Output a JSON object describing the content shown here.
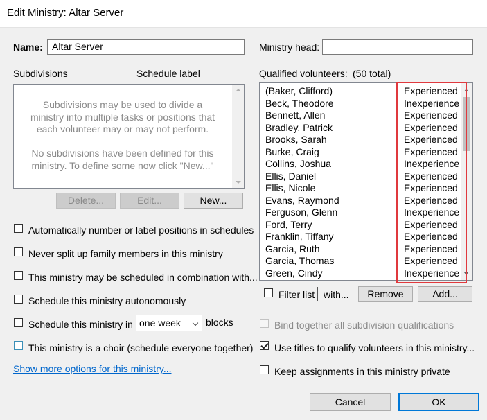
{
  "window": {
    "title": "Edit Ministry: Altar Server"
  },
  "name_field": {
    "label": "Name:",
    "value": "Altar Server"
  },
  "ministry_head": {
    "label": "Ministry head:",
    "value": ""
  },
  "subdivisions": {
    "header": "Subdivisions",
    "schedule_label_header": "Schedule label",
    "empty_text": "Subdivisions may be used to divide a\nministry into multiple tasks or positions that\neach volunteer may or may not perform.\n\nNo subdivisions have been defined for this\nministry. To define some now click \"New...\"",
    "buttons": {
      "delete": "Delete...",
      "edit": "Edit...",
      "new": "New..."
    }
  },
  "qualified": {
    "header": "Qualified volunteers:",
    "total": "(50 total)",
    "volunteers": [
      {
        "name": "(Baker, Clifford)",
        "status": "Experienced"
      },
      {
        "name": "Beck, Theodore",
        "status": "Inexperience"
      },
      {
        "name": "Bennett, Allen",
        "status": "Experienced"
      },
      {
        "name": "Bradley, Patrick",
        "status": "Experienced"
      },
      {
        "name": "Brooks, Sarah",
        "status": "Experienced"
      },
      {
        "name": "Burke, Craig",
        "status": "Experienced"
      },
      {
        "name": "Collins, Joshua",
        "status": "Inexperience"
      },
      {
        "name": "Ellis, Daniel",
        "status": "Experienced"
      },
      {
        "name": "Ellis, Nicole",
        "status": "Experienced"
      },
      {
        "name": "Evans, Raymond",
        "status": "Experienced"
      },
      {
        "name": "Ferguson, Glenn",
        "status": "Inexperience"
      },
      {
        "name": "Ford, Terry",
        "status": "Experienced"
      },
      {
        "name": "Franklin, Tiffany",
        "status": "Experienced"
      },
      {
        "name": "Garcia, Ruth",
        "status": "Experienced"
      },
      {
        "name": "Garcia, Thomas",
        "status": "Experienced"
      },
      {
        "name": "Green, Cindy",
        "status": "Inexperience"
      }
    ],
    "filter_label": "Filter list",
    "with_label": "with...",
    "remove_button": "Remove",
    "add_button": "Add..."
  },
  "options": {
    "auto_number": "Automatically number or label positions in schedules",
    "never_split": "Never split up family members in this ministry",
    "combination": "This ministry may be scheduled in combination with...",
    "autonomous": "Schedule this ministry autonomously",
    "schedule_in": "Schedule this ministry in",
    "blocks_select": "one week",
    "blocks": "blocks",
    "choir": "This ministry is a choir (schedule everyone together)",
    "more_options": "Show more options for this ministry...",
    "bind_together": "Bind together all subdivision qualifications",
    "use_titles": "Use titles to qualify volunteers in this ministry...",
    "keep_private": "Keep assignments in this ministry private"
  },
  "footer": {
    "cancel": "Cancel",
    "ok": "OK"
  },
  "colors": {
    "highlight": "#e0393e",
    "accent": "#0078d7",
    "link": "#0066cc"
  }
}
